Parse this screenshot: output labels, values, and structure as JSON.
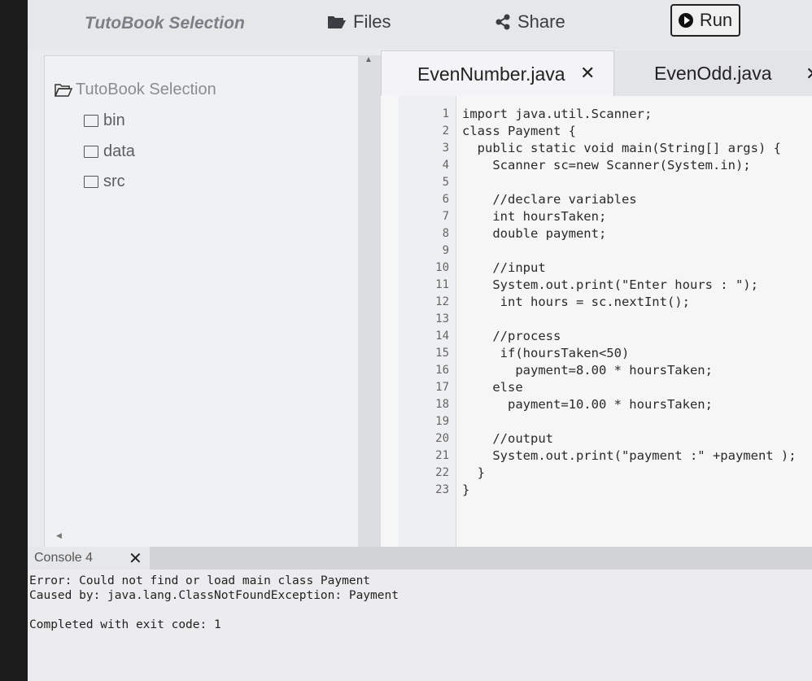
{
  "app": {
    "title": "TutoBook Selection"
  },
  "toolbar": {
    "files_label": "Files",
    "share_label": "Share",
    "run_label": "Run"
  },
  "file_tree": {
    "root_label": "TutoBook Selection",
    "items": [
      "bin",
      "data",
      "src"
    ]
  },
  "editor": {
    "tabs": [
      {
        "label": "EvenNumber.java",
        "active": true
      },
      {
        "label": "EvenOdd.java",
        "active": false
      }
    ],
    "lines": [
      {
        "n": "1",
        "text": "import java.util.Scanner;"
      },
      {
        "n": "2",
        "text": "class Payment {"
      },
      {
        "n": "3",
        "text": "  public static void main(String[] args) {"
      },
      {
        "n": "4",
        "text": "    Scanner sc=new Scanner(System.in);"
      },
      {
        "n": "5",
        "text": ""
      },
      {
        "n": "6",
        "text": "    //declare variables"
      },
      {
        "n": "7",
        "text": "    int hoursTaken;"
      },
      {
        "n": "8",
        "text": "    double payment;"
      },
      {
        "n": "9",
        "text": ""
      },
      {
        "n": "10",
        "text": "    //input"
      },
      {
        "n": "11",
        "text": "    System.out.print(\"Enter hours : \");"
      },
      {
        "n": "12",
        "text": "     int hours = sc.nextInt();"
      },
      {
        "n": "13",
        "text": ""
      },
      {
        "n": "14",
        "text": "    //process"
      },
      {
        "n": "15",
        "text": "     if(hoursTaken<50)"
      },
      {
        "n": "16",
        "text": "       payment=8.00 * hoursTaken;"
      },
      {
        "n": "17",
        "text": "    else"
      },
      {
        "n": "18",
        "text": "      payment=10.00 * hoursTaken;"
      },
      {
        "n": "19",
        "text": ""
      },
      {
        "n": "20",
        "text": "    //output"
      },
      {
        "n": "21",
        "text": "    System.out.print(\"payment :\" +payment );"
      },
      {
        "n": "22",
        "text": "  }"
      },
      {
        "n": "23",
        "text": "}"
      }
    ]
  },
  "console": {
    "tab_label": "Console 4",
    "lines": [
      "Error: Could not find or load main class Payment",
      "Caused by: java.lang.ClassNotFoundException: Payment",
      "",
      "Completed with exit code: 1"
    ]
  }
}
